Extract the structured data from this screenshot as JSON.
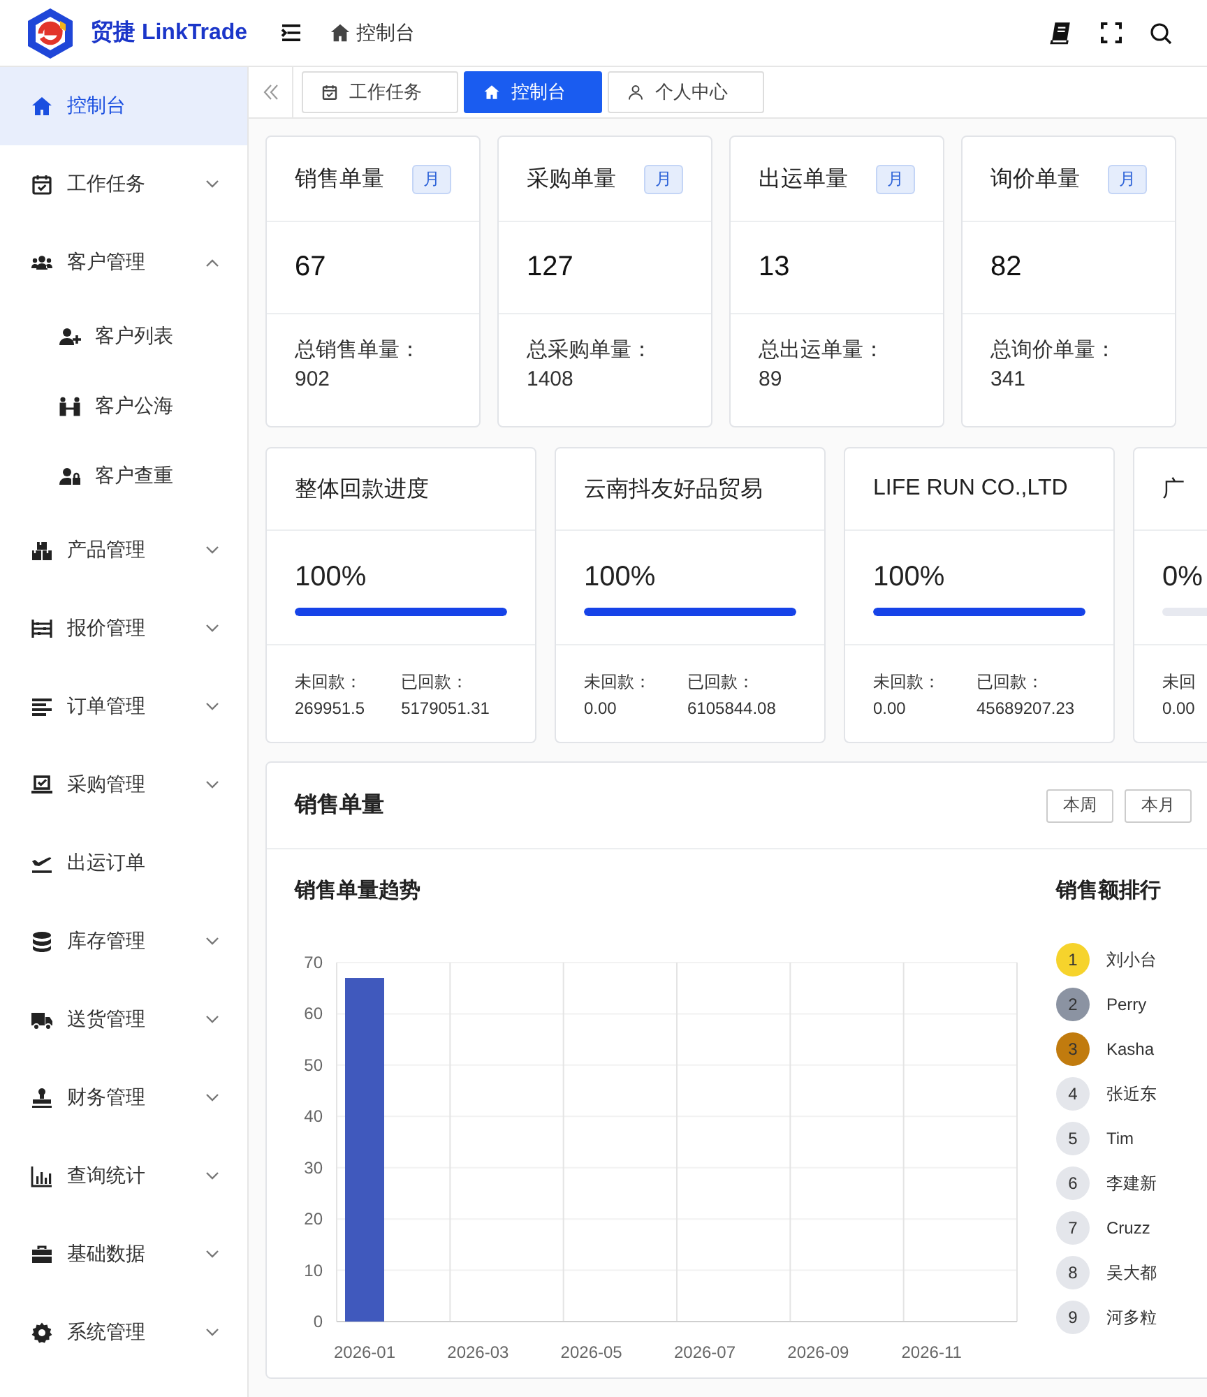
{
  "header": {
    "brand": "贸捷 LinkTrade",
    "breadcrumb": "控制台"
  },
  "sidebar": {
    "items": [
      {
        "label": "控制台",
        "selected": true,
        "expandable": false
      },
      {
        "label": "工作任务",
        "selected": false,
        "expandable": true,
        "expanded": false
      },
      {
        "label": "客户管理",
        "selected": false,
        "expandable": true,
        "expanded": true,
        "children": [
          {
            "label": "客户列表",
            "selected": false
          },
          {
            "label": "客户公海",
            "selected": false
          },
          {
            "label": "客户查重",
            "selected": false
          }
        ]
      },
      {
        "label": "产品管理",
        "selected": false,
        "expandable": true,
        "expanded": false
      },
      {
        "label": "报价管理",
        "selected": false,
        "expandable": true,
        "expanded": false
      },
      {
        "label": "订单管理",
        "selected": false,
        "expandable": true,
        "expanded": false
      },
      {
        "label": "采购管理",
        "selected": false,
        "expandable": true,
        "expanded": false
      },
      {
        "label": "出运订单",
        "selected": false,
        "expandable": false
      },
      {
        "label": "库存管理",
        "selected": false,
        "expandable": true,
        "expanded": false
      },
      {
        "label": "送货管理",
        "selected": false,
        "expandable": true,
        "expanded": false
      },
      {
        "label": "财务管理",
        "selected": false,
        "expandable": true,
        "expanded": false
      },
      {
        "label": "查询统计",
        "selected": false,
        "expandable": true,
        "expanded": false
      },
      {
        "label": "基础数据",
        "selected": false,
        "expandable": true,
        "expanded": false
      },
      {
        "label": "系统管理",
        "selected": false,
        "expandable": true,
        "expanded": false
      }
    ]
  },
  "tabs": [
    {
      "label": "工作任务",
      "selected": false
    },
    {
      "label": "控制台",
      "selected": true
    },
    {
      "label": "个人中心",
      "selected": false
    }
  ],
  "stat_cards": [
    {
      "title": "销售单量",
      "badge": "月",
      "value": "67",
      "total_label": "总销售单量：",
      "total": "902"
    },
    {
      "title": "采购单量",
      "badge": "月",
      "value": "127",
      "total_label": "总采购单量：",
      "total": "1408"
    },
    {
      "title": "出运单量",
      "badge": "月",
      "value": "13",
      "total_label": "总出运单量：",
      "total": "89"
    },
    {
      "title": "询价单量",
      "badge": "月",
      "value": "82",
      "total_label": "总询价单量：",
      "total": "341"
    }
  ],
  "payment_cards": [
    {
      "title": "整体回款进度",
      "percent": "100%",
      "level": 1,
      "unpaid_label": "未回款：",
      "unpaid": "269951.5",
      "paid_label": "已回款：",
      "paid": "5179051.31"
    },
    {
      "title": "云南抖友好品贸易",
      "percent": "100%",
      "level": 1,
      "unpaid_label": "未回款：",
      "unpaid": "0.00",
      "paid_label": "已回款：",
      "paid": "6105844.08"
    },
    {
      "title": "LIFE RUN CO.,LTD",
      "percent": "100%",
      "level": 1,
      "unpaid_label": "未回款：",
      "unpaid": "0.00",
      "paid_label": "已回款：",
      "paid": "45689207.23"
    },
    {
      "title": "广",
      "percent": "0%",
      "level": 0,
      "unpaid_label": "未回",
      "unpaid": "0.00"
    }
  ],
  "sales_panel": {
    "title": "销售单量",
    "buttons": [
      "本周",
      "本月"
    ],
    "trend_title": "销售单量趋势",
    "chart_data": {
      "type": "bar",
      "categories": [
        "2026-01",
        "2026-03",
        "2026-05",
        "2026-07",
        "2026-09",
        "2026-11"
      ],
      "series": [
        {
          "color": "#4059bd",
          "values": [
            67,
            0,
            0,
            0,
            0,
            0
          ]
        }
      ],
      "ylim": [
        0,
        70
      ],
      "yticks": [
        0,
        10,
        20,
        30,
        40,
        50,
        60,
        70
      ],
      "grid": true
    },
    "ranking_title": "销售额排行",
    "ranking": [
      {
        "rank": "1",
        "name": "刘小台",
        "color": "#f6d32c"
      },
      {
        "rank": "2",
        "name": "Perry",
        "color": "#8b93a2"
      },
      {
        "rank": "3",
        "name": "Kasha",
        "color": "#c17b0e"
      },
      {
        "rank": "4",
        "name": "张近东",
        "color": "#e4e6eb"
      },
      {
        "rank": "5",
        "name": "Tim",
        "color": "#e4e6eb"
      },
      {
        "rank": "6",
        "name": "李建新",
        "color": "#e4e6eb"
      },
      {
        "rank": "7",
        "name": "Cruzz",
        "color": "#e4e6eb"
      },
      {
        "rank": "8",
        "name": "吴大都",
        "color": "#e4e6eb"
      },
      {
        "rank": "9",
        "name": "河多粒",
        "color": "#e4e6eb"
      }
    ]
  }
}
